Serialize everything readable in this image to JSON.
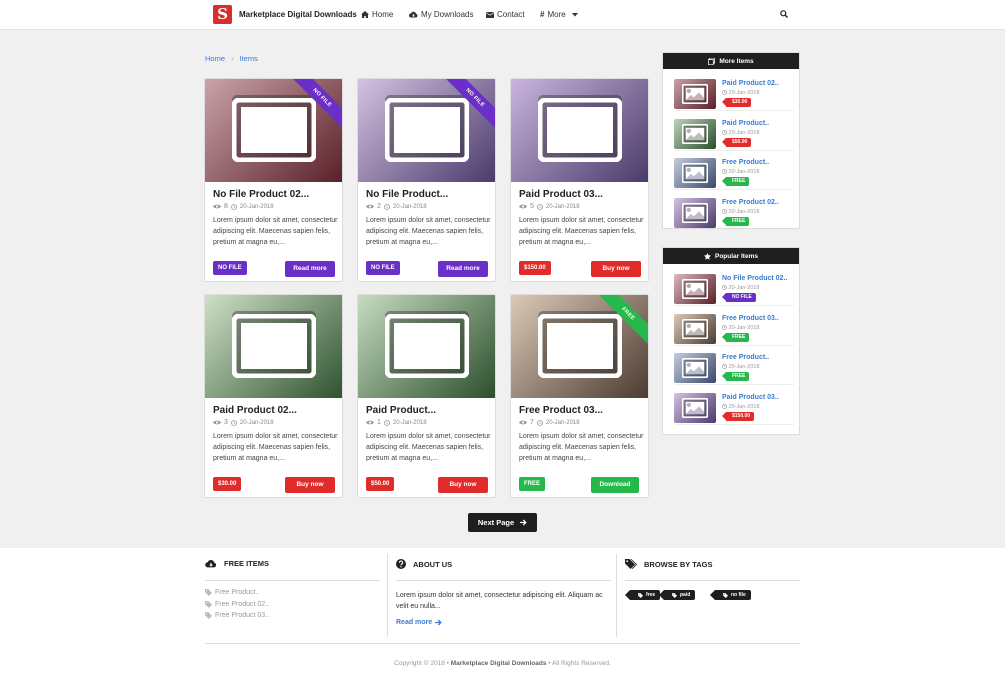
{
  "brand": {
    "name": "Marketplace Digital Downloads",
    "logo_letter": "S",
    "logo_color": "#d92c2c"
  },
  "nav": {
    "home": "Home",
    "downloads": "My Downloads",
    "contact": "Contact",
    "more": "More"
  },
  "breadcrumb": {
    "home": "Home",
    "current": "Items"
  },
  "cards": [
    {
      "title": "No File Product 02...",
      "views": "8",
      "date": "20-Jan-2018",
      "desc": "Lorem ipsum dolor sit amet, consectetur adipiscing elit. Maecenas sapien felis, pretium at magna eu,...",
      "badge": "NO FILE",
      "button": "Read more",
      "ribbon": "NO FILE"
    },
    {
      "title": "No File Product...",
      "views": "2",
      "date": "20-Jan-2018",
      "desc": "Lorem ipsum dolor sit amet, consectetur adipiscing elit. Maecenas sapien felis, pretium at magna eu,...",
      "badge": "NO FILE",
      "button": "Read more",
      "ribbon": "NO FILE"
    },
    {
      "title": "Paid Product 03...",
      "views": "5",
      "date": "20-Jan-2018",
      "desc": "Lorem ipsum dolor sit amet, consectetur adipiscing elit. Maecenas sapien felis, pretium at magna eu,...",
      "badge": "$150.00",
      "button": "Buy now",
      "ribbon": ""
    },
    {
      "title": "Paid Product 02...",
      "views": "3",
      "date": "20-Jan-2018",
      "desc": "Lorem ipsum dolor sit amet, consectetur adipiscing elit. Maecenas sapien felis, pretium at magna eu,...",
      "badge": "$30.00",
      "button": "Buy now",
      "ribbon": ""
    },
    {
      "title": "Paid Product...",
      "views": "1",
      "date": "20-Jan-2018",
      "desc": "Lorem ipsum dolor sit amet, consectetur adipiscing elit. Maecenas sapien felis, pretium at magna eu,...",
      "badge": "$50.00",
      "button": "Buy now",
      "ribbon": ""
    },
    {
      "title": "Free Product 03...",
      "views": "7",
      "date": "20-Jan-2018",
      "desc": "Lorem ipsum dolor sit amet, consectetur adipiscing elit. Maecenas sapien felis, pretium at magna eu,...",
      "badge": "FREE",
      "button": "Download",
      "ribbon": "FREE"
    }
  ],
  "next_page": "Next Page",
  "more_items": {
    "title": "More Items",
    "items": [
      {
        "title": "Paid Product 02..",
        "date": "20-Jan-2018",
        "tag": "$30.00"
      },
      {
        "title": "Paid Product..",
        "date": "20-Jan-2018",
        "tag": "$50.00"
      },
      {
        "title": "Free Product..",
        "date": "20-Jan-2018",
        "tag": "FREE"
      },
      {
        "title": "Free Product 02..",
        "date": "20-Jan-2018",
        "tag": "FREE"
      }
    ]
  },
  "popular_items": {
    "title": "Popular Items",
    "items": [
      {
        "title": "No File Product 02..",
        "date": "20-Jan-2018",
        "tag": "NO FILE"
      },
      {
        "title": "Free Product 03..",
        "date": "20-Jan-2018",
        "tag": "FREE"
      },
      {
        "title": "Free Product..",
        "date": "20-Jan-2018",
        "tag": "FREE"
      },
      {
        "title": "Paid Product 03..",
        "date": "20-Jan-2018",
        "tag": "$150.00"
      }
    ]
  },
  "footer": {
    "free_items": {
      "title": "FREE ITEMS",
      "links": [
        "Free Product..",
        "Free Product 02..",
        "Free Product 03.."
      ]
    },
    "about": {
      "title": "ABOUT US",
      "text": "Lorem ipsum dolor sit amet, consectetur adipiscing elit. Aliquam ac velit eu nulla...",
      "read_more": "Read more"
    },
    "tags": {
      "title": "BROWSE BY TAGS",
      "items": [
        "free",
        "paid",
        "no file"
      ]
    },
    "copyright_prefix": "Copyright © 2018 •",
    "copyright_brand": "Marketplace Digital Downloads",
    "copyright_suffix": "• All Rights Reserved."
  },
  "colors": {
    "accent": "#3a7bd5",
    "nofile": "#6a2fc7",
    "paid": "#e22b2b",
    "free": "#25b84a",
    "dark": "#1e1e1e"
  }
}
